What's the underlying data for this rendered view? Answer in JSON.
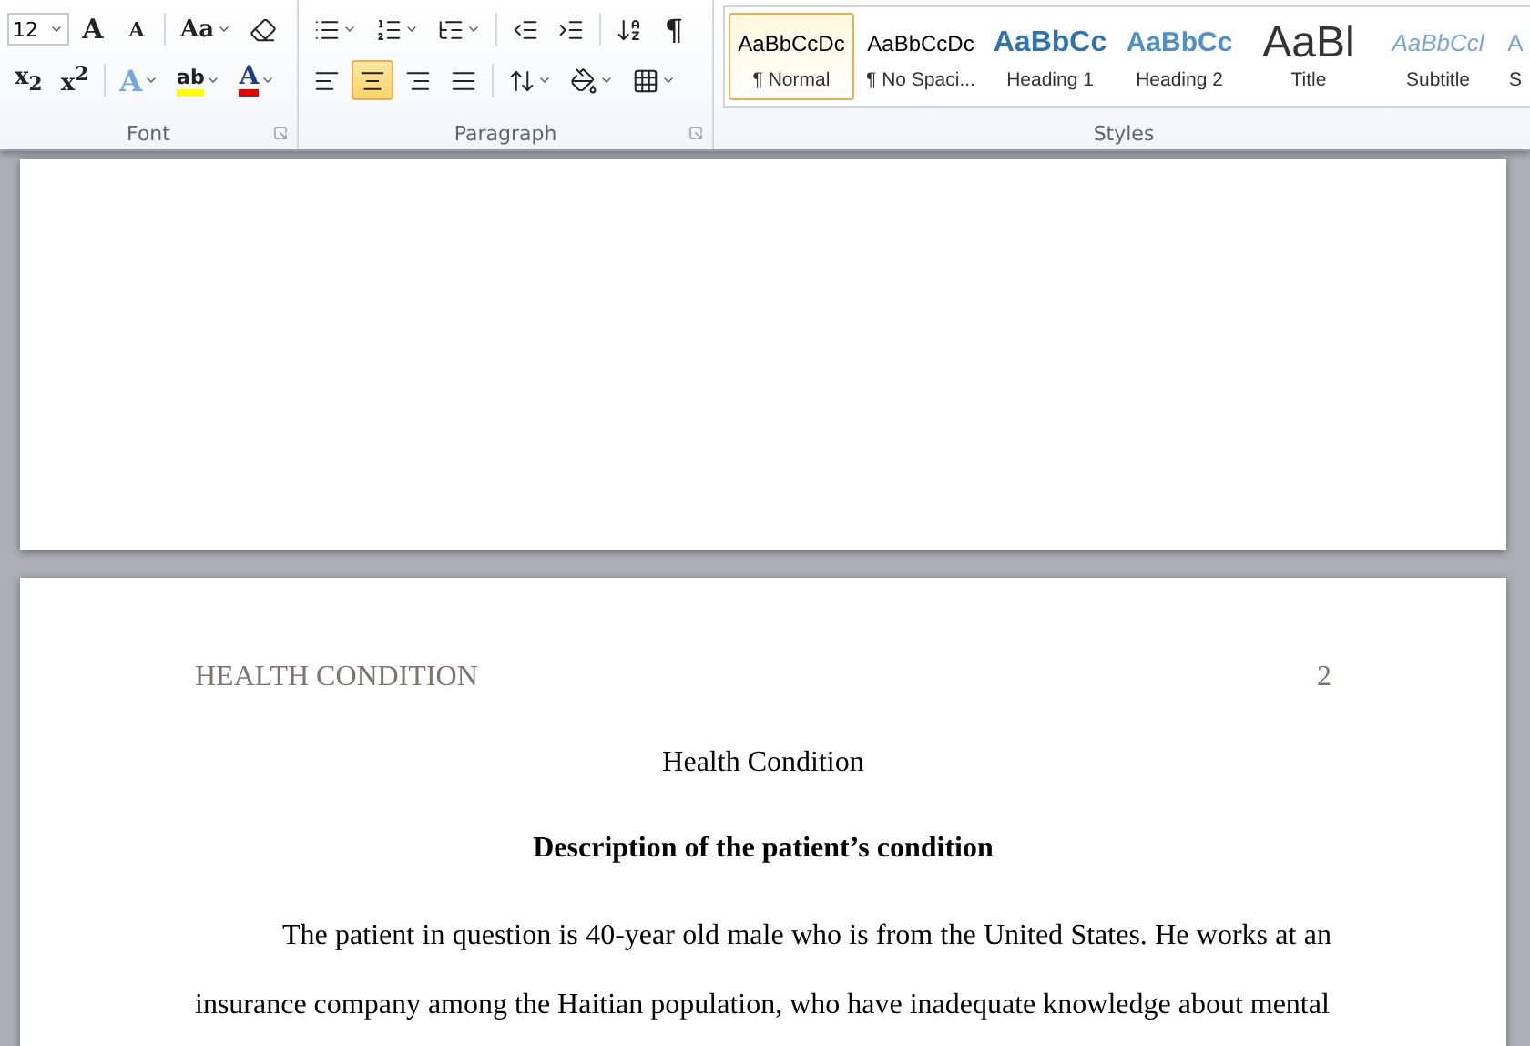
{
  "font": {
    "label": "Font",
    "size": "12",
    "row1": [
      {
        "kind": "grow",
        "label": "A"
      },
      {
        "kind": "shrink",
        "label": "A"
      },
      {
        "kind": "case",
        "label": "Aa"
      },
      {
        "kind": "clear"
      }
    ],
    "row2": [
      {
        "kind": "subscript",
        "label": "x$_{2}$"
      },
      {
        "kind": "superscript",
        "label": "x$^{2}$"
      },
      {
        "kind": "effects",
        "label": "A"
      },
      {
        "kind": "highlight",
        "label": "ab"
      },
      {
        "kind": "color",
        "label": "A"
      }
    ]
  },
  "paragraph": {
    "label": "Paragraph",
    "row1": [
      {
        "kind": "bullets"
      },
      {
        "kind": "numbering"
      },
      {
        "kind": "multilevel"
      },
      {
        "kind": "outdent"
      },
      {
        "kind": "indent"
      },
      {
        "kind": "sort"
      },
      {
        "kind": "marks",
        "label": "¶"
      }
    ],
    "alignments": [
      {
        "kind": "left",
        "selected": false
      },
      {
        "kind": "center",
        "selected": true
      },
      {
        "kind": "right",
        "selected": false
      },
      {
        "kind": "justify",
        "selected": false
      }
    ],
    "row2": [
      {
        "kind": "spacing"
      },
      {
        "kind": "shading"
      },
      {
        "kind": "borders"
      }
    ]
  },
  "styles": {
    "label": "Styles",
    "items": [
      {
        "kind": "normal",
        "preview": "AaBbCcDc",
        "name": "¶ Normal",
        "selected": true
      },
      {
        "kind": "normal",
        "preview": "AaBbCcDc",
        "name": "¶ No Spaci...",
        "selected": false
      },
      {
        "kind": "heading1",
        "preview": "AaBbCc",
        "name": "Heading 1",
        "selected": false
      },
      {
        "kind": "heading2",
        "preview": "AaBbCc",
        "name": "Heading 2",
        "selected": false
      },
      {
        "kind": "title",
        "preview": "AaBl",
        "name": "Title",
        "selected": false
      },
      {
        "kind": "subtitle",
        "preview": "AaBbCcl",
        "name": "Subtitle",
        "selected": false
      },
      {
        "kind": "partial",
        "preview": "A",
        "name": "S",
        "selected": false
      }
    ]
  },
  "document": {
    "header": {
      "title": "HEALTH CONDITION",
      "page": "2"
    },
    "blocks": [
      {
        "kind": "title",
        "text": "Health Condition"
      },
      {
        "kind": "heading",
        "text": "Description of the patient’s condition"
      },
      {
        "kind": "paragraph",
        "text": "The patient in question is 40-year old male who is from the United States. He works at an insurance company among the Haitian population, who have inadequate knowledge about mental"
      }
    ]
  }
}
